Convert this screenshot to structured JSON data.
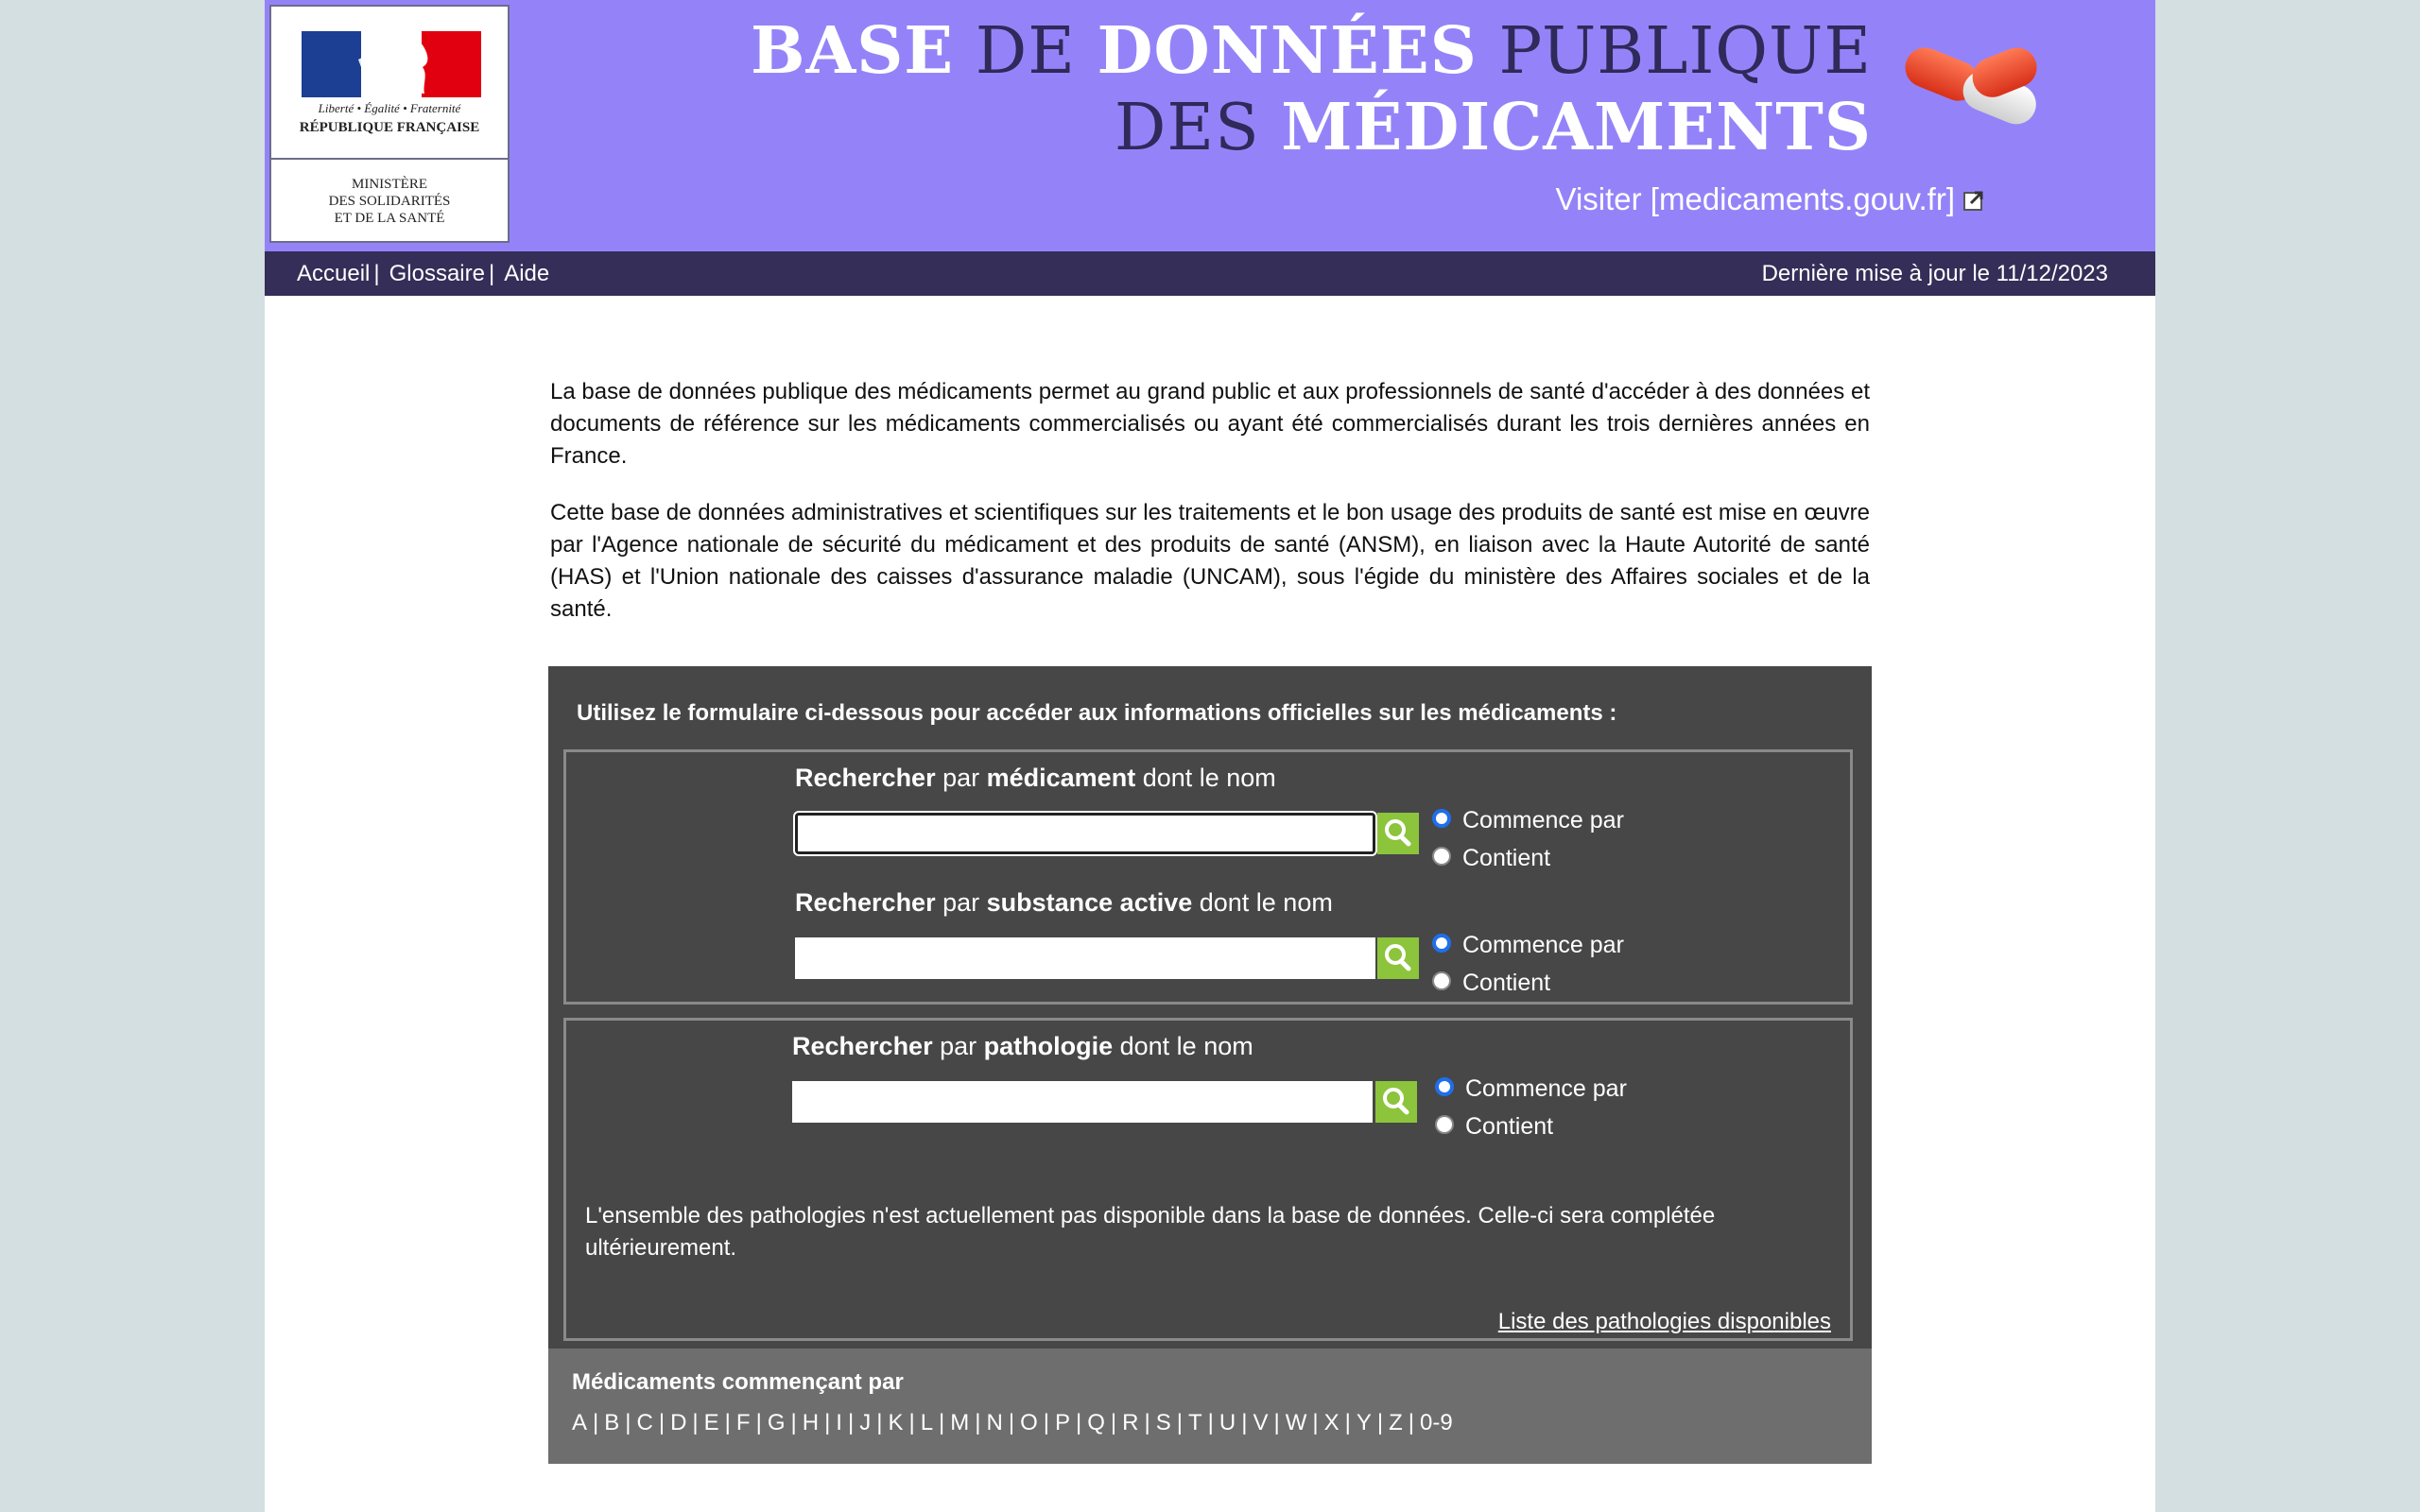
{
  "logo": {
    "motto": "Liberté • Égalité • Fraternité",
    "republic": "RÉPUBLIQUE FRANÇAISE",
    "ministry_lines": [
      "MINISTÈRE",
      "DES SOLIDARITÉS",
      "ET DE LA SANTÉ"
    ]
  },
  "header": {
    "title_line1": [
      {
        "text": "BASE",
        "style": "white"
      },
      {
        "text": " DE ",
        "style": "dark"
      },
      {
        "text": "DONNÉES",
        "style": "white"
      },
      {
        "text": " PUBLIQUE",
        "style": "dark"
      }
    ],
    "title_line2": [
      {
        "text": "DES ",
        "style": "dark"
      },
      {
        "text": "MÉDICAMENTS",
        "style": "white"
      }
    ],
    "visit_link": "Visiter [medicaments.gouv.fr]",
    "pill_icon": "capsule-icon",
    "external_icon": "external-link-icon"
  },
  "nav": {
    "links": [
      "Accueil",
      "Glossaire",
      "Aide"
    ],
    "separator": "|",
    "last_update": "Dernière mise à jour le 11/12/2023"
  },
  "intro": {
    "p1": "La base de données publique des médicaments permet au grand public et aux professionnels de santé d'accéder à des données et documents de référence sur les médicaments commercialisés ou ayant été commercialisés durant les trois dernières années en France.",
    "p2": "Cette base de données administratives et scientifiques sur les traitements et le bon usage des produits de santé est mise en œuvre par l'Agence nationale de sécurité du médicament et des produits de santé (ANSM), en liaison avec la Haute Autorité de santé (HAS) et l'Union nationale des caisses d'assurance maladie (UNCAM), sous l'égide du ministère des Affaires sociales et de la santé."
  },
  "panel": {
    "intro": "Utilisez le formulaire ci-dessous pour accéder aux informations officielles sur les médicaments :",
    "search_medicament": {
      "prefix": "Rechercher",
      "mid": " par ",
      "keyword": "médicament",
      "suffix": " dont le nom",
      "value": "",
      "options": [
        "Commence par",
        "Contient"
      ],
      "selected": "Commence par"
    },
    "search_substance": {
      "prefix": "Rechercher",
      "mid": " par ",
      "keyword": "substance active",
      "suffix": " dont le nom",
      "value": "",
      "options": [
        "Commence par",
        "Contient"
      ],
      "selected": "Commence par"
    },
    "search_pathologie": {
      "prefix": "Rechercher",
      "mid": " par ",
      "keyword": "pathologie",
      "suffix": " dont le nom",
      "value": "",
      "options": [
        "Commence par",
        "Contient"
      ],
      "selected": "Commence par"
    },
    "patho_note": "L'ensemble des pathologies n'est actuellement pas disponible dans la base de données. Celle-ci sera complétée ultérieurement.",
    "patho_list_link": "Liste des pathologies disponibles",
    "search_icon": "magnifier-icon"
  },
  "alpha": {
    "title": "Médicaments commençant par",
    "letters": [
      "A",
      "B",
      "C",
      "D",
      "E",
      "F",
      "G",
      "H",
      "I",
      "J",
      "K",
      "L",
      "M",
      "N",
      "O",
      "P",
      "Q",
      "R",
      "S",
      "T",
      "U",
      "V",
      "W",
      "X",
      "Y",
      "Z",
      "0-9"
    ]
  },
  "colors": {
    "banner": "#9483f8",
    "navbar": "#342e58",
    "panel": "#474747",
    "alpha_box": "#6e6e6e",
    "search_button": "#8cc43c",
    "flag_blue": "#1c3f94",
    "flag_red": "#e1000f"
  }
}
